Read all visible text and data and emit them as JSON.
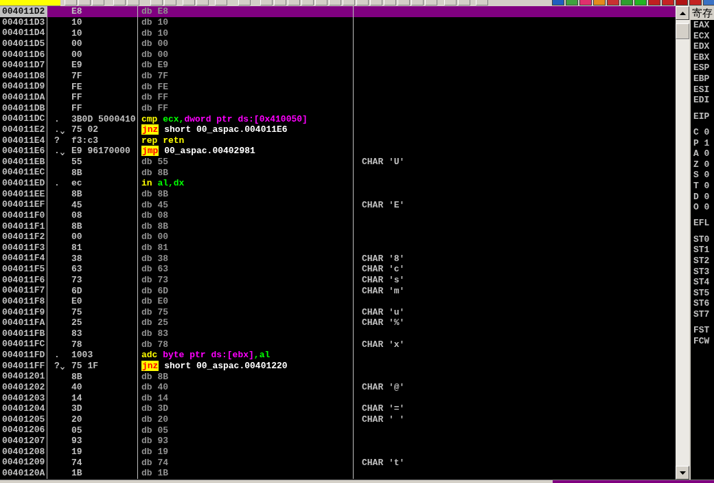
{
  "disassembly": {
    "rows": [
      {
        "address": "004011D2",
        "hex": "E8",
        "jump": false,
        "selected": true,
        "instruction": [
          {
            "kind": "data",
            "text": "db E8"
          }
        ]
      },
      {
        "address": "004011D3",
        "hex": "10",
        "jump": false,
        "selected": false,
        "instruction": [
          {
            "kind": "data",
            "text": "db 10"
          }
        ]
      },
      {
        "address": "004011D4",
        "hex": "10",
        "jump": false,
        "selected": false,
        "instruction": [
          {
            "kind": "data",
            "text": "db 10"
          }
        ]
      },
      {
        "address": "004011D5",
        "hex": "00",
        "jump": false,
        "selected": false,
        "instruction": [
          {
            "kind": "data",
            "text": "db 00"
          }
        ]
      },
      {
        "address": "004011D6",
        "hex": "00",
        "jump": false,
        "selected": false,
        "instruction": [
          {
            "kind": "data",
            "text": "db 00"
          }
        ]
      },
      {
        "address": "004011D7",
        "hex": "E9",
        "jump": false,
        "selected": false,
        "instruction": [
          {
            "kind": "data",
            "text": "db E9"
          }
        ]
      },
      {
        "address": "004011D8",
        "hex": "7F",
        "jump": false,
        "selected": false,
        "instruction": [
          {
            "kind": "data",
            "text": "db 7F"
          }
        ]
      },
      {
        "address": "004011D9",
        "hex": "FE",
        "jump": false,
        "selected": false,
        "instruction": [
          {
            "kind": "data",
            "text": "db FE"
          }
        ]
      },
      {
        "address": "004011DA",
        "hex": "FF",
        "jump": false,
        "selected": false,
        "instruction": [
          {
            "kind": "data",
            "text": "db FF"
          }
        ]
      },
      {
        "address": "004011DB",
        "hex": "FF",
        "jump": false,
        "selected": false,
        "instruction": [
          {
            "kind": "data",
            "text": "db FF"
          }
        ]
      },
      {
        "address": "004011DC",
        "marker": ".",
        "hex": "3B0D 5000410",
        "jump": false,
        "selected": false,
        "instruction": [
          {
            "kind": "mnemonic",
            "text": "cmp"
          },
          {
            "kind": "register",
            "text": " ecx,"
          },
          {
            "kind": "memory",
            "text": "dword ptr ds:[0x410050]"
          }
        ]
      },
      {
        "address": "004011E2",
        "marker": ".",
        "hex": "75 02",
        "jump": true,
        "selected": false,
        "instruction": [
          {
            "kind": "jump",
            "text": "jnz"
          },
          {
            "kind": "target",
            "text": " short 00_aspac.004011E6"
          }
        ]
      },
      {
        "address": "004011E4",
        "marker": "?",
        "hex": "f3:c3",
        "jump": false,
        "selected": false,
        "instruction": [
          {
            "kind": "mnemonic",
            "text": "rep retn"
          }
        ]
      },
      {
        "address": "004011E6",
        "marker": ".",
        "hex": "E9 96170000",
        "jump": true,
        "selected": false,
        "instruction": [
          {
            "kind": "jump",
            "text": "jmp"
          },
          {
            "kind": "target",
            "text": " 00_aspac.00402981"
          }
        ]
      },
      {
        "address": "004011EB",
        "hex": "55",
        "jump": false,
        "selected": false,
        "instruction": [
          {
            "kind": "data",
            "text": "db 55"
          }
        ],
        "comment": "CHAR 'U'"
      },
      {
        "address": "004011EC",
        "hex": "8B",
        "jump": false,
        "selected": false,
        "instruction": [
          {
            "kind": "data",
            "text": "db 8B"
          }
        ]
      },
      {
        "address": "004011ED",
        "marker": ".",
        "hex": "ec",
        "jump": false,
        "selected": false,
        "instruction": [
          {
            "kind": "mnemonic",
            "text": "in"
          },
          {
            "kind": "register",
            "text": " al,dx"
          }
        ]
      },
      {
        "address": "004011EE",
        "hex": "8B",
        "jump": false,
        "selected": false,
        "instruction": [
          {
            "kind": "data",
            "text": "db 8B"
          }
        ]
      },
      {
        "address": "004011EF",
        "hex": "45",
        "jump": false,
        "selected": false,
        "instruction": [
          {
            "kind": "data",
            "text": "db 45"
          }
        ],
        "comment": "CHAR 'E'"
      },
      {
        "address": "004011F0",
        "hex": "08",
        "jump": false,
        "selected": false,
        "instruction": [
          {
            "kind": "data",
            "text": "db 08"
          }
        ]
      },
      {
        "address": "004011F1",
        "hex": "8B",
        "jump": false,
        "selected": false,
        "instruction": [
          {
            "kind": "data",
            "text": "db 8B"
          }
        ]
      },
      {
        "address": "004011F2",
        "hex": "00",
        "jump": false,
        "selected": false,
        "instruction": [
          {
            "kind": "data",
            "text": "db 00"
          }
        ]
      },
      {
        "address": "004011F3",
        "hex": "81",
        "jump": false,
        "selected": false,
        "instruction": [
          {
            "kind": "data",
            "text": "db 81"
          }
        ]
      },
      {
        "address": "004011F4",
        "hex": "38",
        "jump": false,
        "selected": false,
        "instruction": [
          {
            "kind": "data",
            "text": "db 38"
          }
        ],
        "comment": "CHAR '8'"
      },
      {
        "address": "004011F5",
        "hex": "63",
        "jump": false,
        "selected": false,
        "instruction": [
          {
            "kind": "data",
            "text": "db 63"
          }
        ],
        "comment": "CHAR 'c'"
      },
      {
        "address": "004011F6",
        "hex": "73",
        "jump": false,
        "selected": false,
        "instruction": [
          {
            "kind": "data",
            "text": "db 73"
          }
        ],
        "comment": "CHAR 's'"
      },
      {
        "address": "004011F7",
        "hex": "6D",
        "jump": false,
        "selected": false,
        "instruction": [
          {
            "kind": "data",
            "text": "db 6D"
          }
        ],
        "comment": "CHAR 'm'"
      },
      {
        "address": "004011F8",
        "hex": "E0",
        "jump": false,
        "selected": false,
        "instruction": [
          {
            "kind": "data",
            "text": "db E0"
          }
        ]
      },
      {
        "address": "004011F9",
        "hex": "75",
        "jump": false,
        "selected": false,
        "instruction": [
          {
            "kind": "data",
            "text": "db 75"
          }
        ],
        "comment": "CHAR 'u'"
      },
      {
        "address": "004011FA",
        "hex": "25",
        "jump": false,
        "selected": false,
        "instruction": [
          {
            "kind": "data",
            "text": "db 25"
          }
        ],
        "comment": "CHAR '%'"
      },
      {
        "address": "004011FB",
        "hex": "83",
        "jump": false,
        "selected": false,
        "instruction": [
          {
            "kind": "data",
            "text": "db 83"
          }
        ]
      },
      {
        "address": "004011FC",
        "hex": "78",
        "jump": false,
        "selected": false,
        "instruction": [
          {
            "kind": "data",
            "text": "db 78"
          }
        ],
        "comment": "CHAR 'x'"
      },
      {
        "address": "004011FD",
        "marker": ".",
        "hex": "1003",
        "jump": false,
        "selected": false,
        "instruction": [
          {
            "kind": "mnemonic",
            "text": "adc"
          },
          {
            "kind": "memory",
            "text": " byte ptr ds:[ebx]"
          },
          {
            "kind": "register",
            "text": ",al"
          }
        ]
      },
      {
        "address": "004011FF",
        "marker": "?",
        "hex": "75 1F",
        "jump": true,
        "selected": false,
        "instruction": [
          {
            "kind": "jump",
            "text": "jnz"
          },
          {
            "kind": "target",
            "text": " short 00_aspac.00401220"
          }
        ]
      },
      {
        "address": "00401201",
        "hex": "8B",
        "jump": false,
        "selected": false,
        "instruction": [
          {
            "kind": "data",
            "text": "db 8B"
          }
        ]
      },
      {
        "address": "00401202",
        "hex": "40",
        "jump": false,
        "selected": false,
        "instruction": [
          {
            "kind": "data",
            "text": "db 40"
          }
        ],
        "comment": "CHAR '@'"
      },
      {
        "address": "00401203",
        "hex": "14",
        "jump": false,
        "selected": false,
        "instruction": [
          {
            "kind": "data",
            "text": "db 14"
          }
        ]
      },
      {
        "address": "00401204",
        "hex": "3D",
        "jump": false,
        "selected": false,
        "instruction": [
          {
            "kind": "data",
            "text": "db 3D"
          }
        ],
        "comment": "CHAR '='"
      },
      {
        "address": "00401205",
        "hex": "20",
        "jump": false,
        "selected": false,
        "instruction": [
          {
            "kind": "data",
            "text": "db 20"
          }
        ],
        "comment": "CHAR ' '"
      },
      {
        "address": "00401206",
        "hex": "05",
        "jump": false,
        "selected": false,
        "instruction": [
          {
            "kind": "data",
            "text": "db 05"
          }
        ]
      },
      {
        "address": "00401207",
        "hex": "93",
        "jump": false,
        "selected": false,
        "instruction": [
          {
            "kind": "data",
            "text": "db 93"
          }
        ]
      },
      {
        "address": "00401208",
        "hex": "19",
        "jump": false,
        "selected": false,
        "instruction": [
          {
            "kind": "data",
            "text": "db 19"
          }
        ]
      },
      {
        "address": "00401209",
        "hex": "74",
        "jump": false,
        "selected": false,
        "instruction": [
          {
            "kind": "data",
            "text": "db 74"
          }
        ],
        "comment": "CHAR 't'"
      },
      {
        "address": "0040120A",
        "hex": "1B",
        "jump": false,
        "selected": false,
        "instruction": [
          {
            "kind": "data",
            "text": "db 1B"
          }
        ]
      }
    ]
  },
  "registers": {
    "title": "寄存",
    "groups": [
      [
        "EAX",
        "ECX",
        "EDX",
        "EBX",
        "ESP",
        "EBP",
        "ESI",
        "EDI"
      ],
      [
        "EIP"
      ],
      [
        "C 0",
        "P 1",
        "A 0",
        "Z 0",
        "S 0",
        "T 0",
        "D 0",
        "O 0"
      ],
      [
        "EFL"
      ],
      [
        "ST0",
        "ST1",
        "ST2",
        "ST3",
        "ST4",
        "ST5",
        "ST6",
        "ST7"
      ],
      [
        "FST",
        "FCW"
      ]
    ]
  }
}
